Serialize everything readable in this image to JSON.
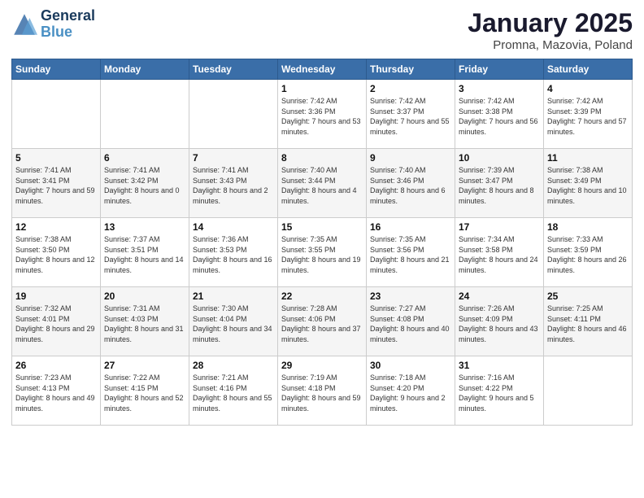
{
  "logo": {
    "line1": "General",
    "line2": "Blue"
  },
  "title": "January 2025",
  "subtitle": "Promna, Mazovia, Poland",
  "weekdays": [
    "Sunday",
    "Monday",
    "Tuesday",
    "Wednesday",
    "Thursday",
    "Friday",
    "Saturday"
  ],
  "weeks": [
    [
      {
        "day": "",
        "info": ""
      },
      {
        "day": "",
        "info": ""
      },
      {
        "day": "",
        "info": ""
      },
      {
        "day": "1",
        "info": "Sunrise: 7:42 AM\nSunset: 3:36 PM\nDaylight: 7 hours and 53 minutes."
      },
      {
        "day": "2",
        "info": "Sunrise: 7:42 AM\nSunset: 3:37 PM\nDaylight: 7 hours and 55 minutes."
      },
      {
        "day": "3",
        "info": "Sunrise: 7:42 AM\nSunset: 3:38 PM\nDaylight: 7 hours and 56 minutes."
      },
      {
        "day": "4",
        "info": "Sunrise: 7:42 AM\nSunset: 3:39 PM\nDaylight: 7 hours and 57 minutes."
      }
    ],
    [
      {
        "day": "5",
        "info": "Sunrise: 7:41 AM\nSunset: 3:41 PM\nDaylight: 7 hours and 59 minutes."
      },
      {
        "day": "6",
        "info": "Sunrise: 7:41 AM\nSunset: 3:42 PM\nDaylight: 8 hours and 0 minutes."
      },
      {
        "day": "7",
        "info": "Sunrise: 7:41 AM\nSunset: 3:43 PM\nDaylight: 8 hours and 2 minutes."
      },
      {
        "day": "8",
        "info": "Sunrise: 7:40 AM\nSunset: 3:44 PM\nDaylight: 8 hours and 4 minutes."
      },
      {
        "day": "9",
        "info": "Sunrise: 7:40 AM\nSunset: 3:46 PM\nDaylight: 8 hours and 6 minutes."
      },
      {
        "day": "10",
        "info": "Sunrise: 7:39 AM\nSunset: 3:47 PM\nDaylight: 8 hours and 8 minutes."
      },
      {
        "day": "11",
        "info": "Sunrise: 7:38 AM\nSunset: 3:49 PM\nDaylight: 8 hours and 10 minutes."
      }
    ],
    [
      {
        "day": "12",
        "info": "Sunrise: 7:38 AM\nSunset: 3:50 PM\nDaylight: 8 hours and 12 minutes."
      },
      {
        "day": "13",
        "info": "Sunrise: 7:37 AM\nSunset: 3:51 PM\nDaylight: 8 hours and 14 minutes."
      },
      {
        "day": "14",
        "info": "Sunrise: 7:36 AM\nSunset: 3:53 PM\nDaylight: 8 hours and 16 minutes."
      },
      {
        "day": "15",
        "info": "Sunrise: 7:35 AM\nSunset: 3:55 PM\nDaylight: 8 hours and 19 minutes."
      },
      {
        "day": "16",
        "info": "Sunrise: 7:35 AM\nSunset: 3:56 PM\nDaylight: 8 hours and 21 minutes."
      },
      {
        "day": "17",
        "info": "Sunrise: 7:34 AM\nSunset: 3:58 PM\nDaylight: 8 hours and 24 minutes."
      },
      {
        "day": "18",
        "info": "Sunrise: 7:33 AM\nSunset: 3:59 PM\nDaylight: 8 hours and 26 minutes."
      }
    ],
    [
      {
        "day": "19",
        "info": "Sunrise: 7:32 AM\nSunset: 4:01 PM\nDaylight: 8 hours and 29 minutes."
      },
      {
        "day": "20",
        "info": "Sunrise: 7:31 AM\nSunset: 4:03 PM\nDaylight: 8 hours and 31 minutes."
      },
      {
        "day": "21",
        "info": "Sunrise: 7:30 AM\nSunset: 4:04 PM\nDaylight: 8 hours and 34 minutes."
      },
      {
        "day": "22",
        "info": "Sunrise: 7:28 AM\nSunset: 4:06 PM\nDaylight: 8 hours and 37 minutes."
      },
      {
        "day": "23",
        "info": "Sunrise: 7:27 AM\nSunset: 4:08 PM\nDaylight: 8 hours and 40 minutes."
      },
      {
        "day": "24",
        "info": "Sunrise: 7:26 AM\nSunset: 4:09 PM\nDaylight: 8 hours and 43 minutes."
      },
      {
        "day": "25",
        "info": "Sunrise: 7:25 AM\nSunset: 4:11 PM\nDaylight: 8 hours and 46 minutes."
      }
    ],
    [
      {
        "day": "26",
        "info": "Sunrise: 7:23 AM\nSunset: 4:13 PM\nDaylight: 8 hours and 49 minutes."
      },
      {
        "day": "27",
        "info": "Sunrise: 7:22 AM\nSunset: 4:15 PM\nDaylight: 8 hours and 52 minutes."
      },
      {
        "day": "28",
        "info": "Sunrise: 7:21 AM\nSunset: 4:16 PM\nDaylight: 8 hours and 55 minutes."
      },
      {
        "day": "29",
        "info": "Sunrise: 7:19 AM\nSunset: 4:18 PM\nDaylight: 8 hours and 59 minutes."
      },
      {
        "day": "30",
        "info": "Sunrise: 7:18 AM\nSunset: 4:20 PM\nDaylight: 9 hours and 2 minutes."
      },
      {
        "day": "31",
        "info": "Sunrise: 7:16 AM\nSunset: 4:22 PM\nDaylight: 9 hours and 5 minutes."
      },
      {
        "day": "",
        "info": ""
      }
    ]
  ]
}
